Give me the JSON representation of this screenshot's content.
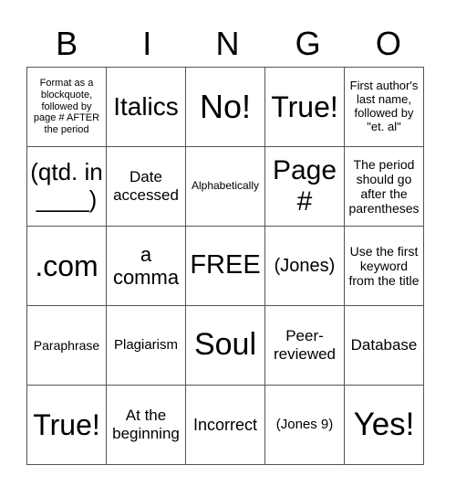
{
  "header": [
    "B",
    "I",
    "N",
    "G",
    "O"
  ],
  "rows": [
    [
      {
        "t": "Format as a blockquote, followed by page # AFTER the period",
        "s": 11
      },
      {
        "t": "Italics",
        "s": 28
      },
      {
        "t": "No!",
        "s": 36
      },
      {
        "t": "True!",
        "s": 32
      },
      {
        "t": "First author's last name, followed by \"et. al\"",
        "s": 13
      }
    ],
    [
      {
        "t": "(qtd. in ____)",
        "s": 26
      },
      {
        "t": "Date accessed",
        "s": 17
      },
      {
        "t": "Alphabetically",
        "s": 12
      },
      {
        "t": "Page #",
        "s": 30
      },
      {
        "t": "The period should go after the parentheses",
        "s": 14
      }
    ],
    [
      {
        "t": ".com",
        "s": 32
      },
      {
        "t": "a comma",
        "s": 22
      },
      {
        "t": "FREE",
        "s": 29
      },
      {
        "t": "(Jones)",
        "s": 20
      },
      {
        "t": "Use the first keyword from the title",
        "s": 14
      }
    ],
    [
      {
        "t": "Paraphrase",
        "s": 14
      },
      {
        "t": "Plagiarism",
        "s": 15
      },
      {
        "t": "Soul",
        "s": 34
      },
      {
        "t": "Peer-reviewed",
        "s": 17
      },
      {
        "t": "Database",
        "s": 17
      }
    ],
    [
      {
        "t": "True!",
        "s": 32
      },
      {
        "t": "At the beginning",
        "s": 17
      },
      {
        "t": "Incorrect",
        "s": 18
      },
      {
        "t": "(Jones 9)",
        "s": 15
      },
      {
        "t": "Yes!",
        "s": 35
      }
    ]
  ]
}
